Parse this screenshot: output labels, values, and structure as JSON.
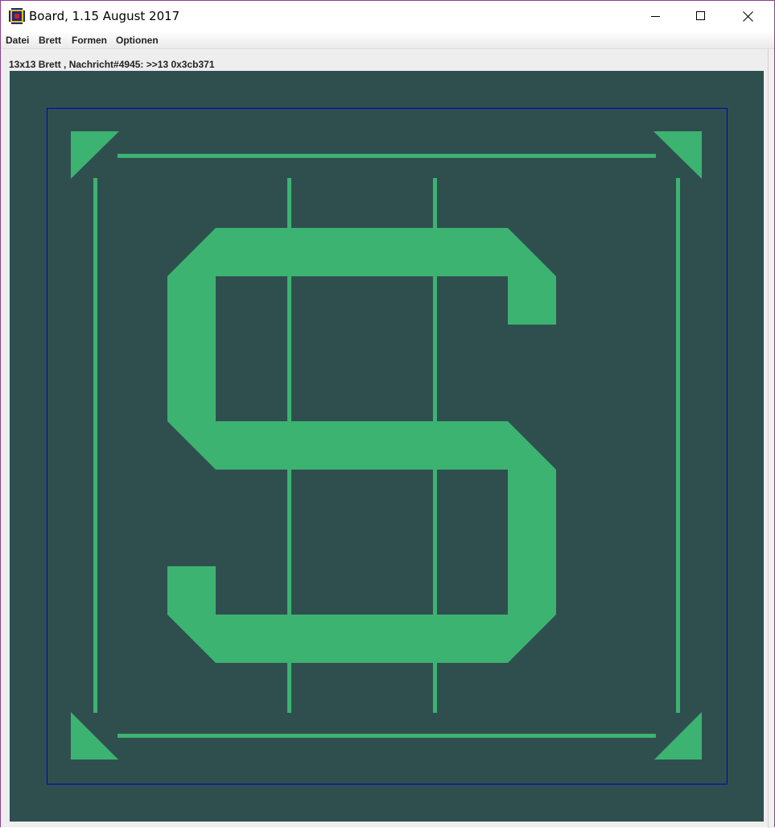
{
  "window": {
    "title": "Board, 1.15 August 2017",
    "icon": "board-app-icon",
    "controls": [
      "minimize-icon",
      "maximize-icon",
      "close-icon"
    ]
  },
  "menu": {
    "items": [
      "Datei",
      "Brett",
      "Formen",
      "Optionen"
    ]
  },
  "status": {
    "text": "13x13 Brett , Nachricht#4945: >>13 0x3cb371"
  },
  "board": {
    "background_color": "#2f4f4f",
    "shape_color": "#3cb371",
    "frame_color": "#0000cc",
    "symbol": "dollar-sign"
  }
}
